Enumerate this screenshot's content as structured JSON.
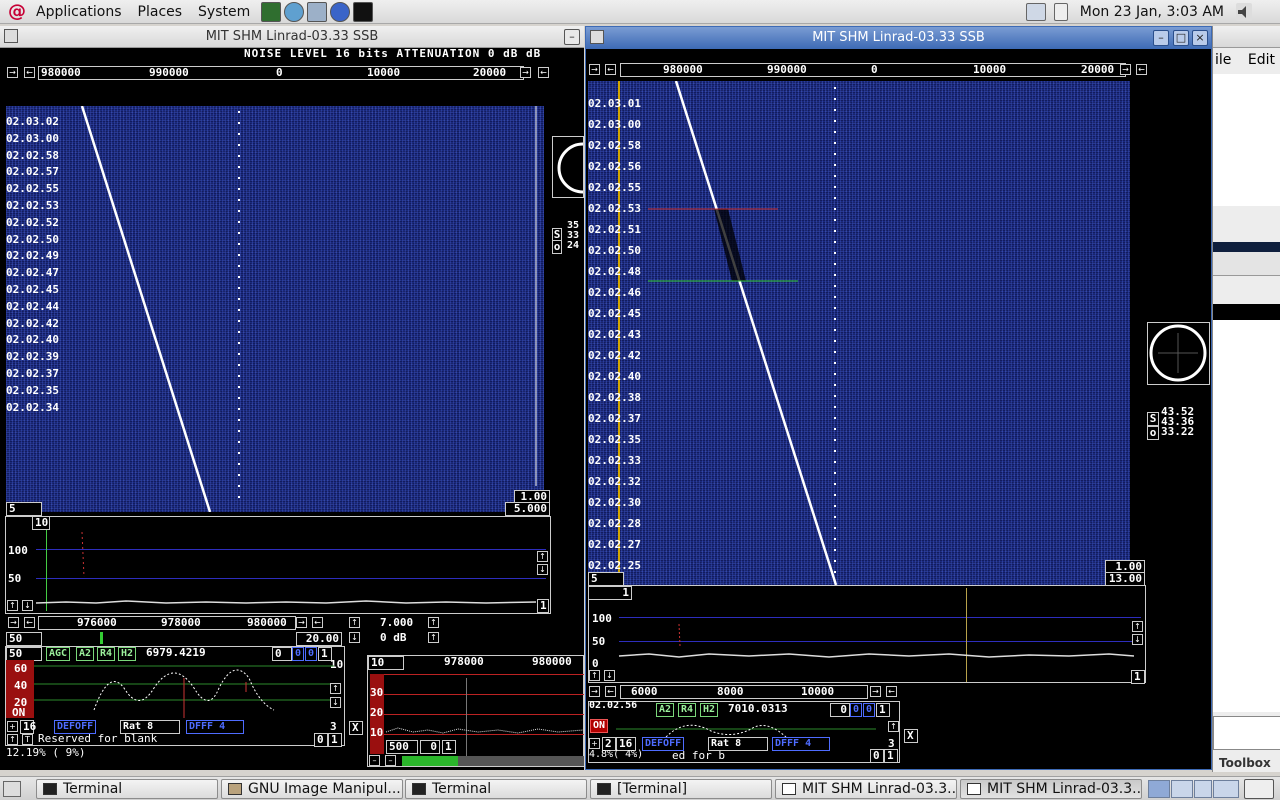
{
  "top_panel": {
    "menus": [
      "Applications",
      "Places",
      "System"
    ],
    "clock": "Mon 23 Jan,  3:03 AM"
  },
  "left_window": {
    "title": "MIT SHM Linrad-03.33 SSB",
    "status_line": "NOISE LEVEL 16 bits ATTENUATION 0 dB dB",
    "freq_scale": [
      "980000",
      "990000",
      "0",
      "10000",
      "20000"
    ],
    "times": [
      "02.03.02",
      "02.03.00",
      "02.02.58",
      "02.02.57",
      "02.02.55",
      "02.02.53",
      "02.02.52",
      "02.02.50",
      "02.02.49",
      "02.02.47",
      "02.02.45",
      "02.02.44",
      "02.02.42",
      "02.02.40",
      "02.02.39",
      "02.02.37",
      "02.02.35",
      "02.02.34"
    ],
    "wf_bottom_left": "5",
    "wf_gain": "1.00",
    "wf_zero": "5.000",
    "side_readout": [
      "35",
      "33",
      "24"
    ],
    "side_labels": [
      "S",
      "o"
    ],
    "spectrum_top_box": "10",
    "spectrum_y": [
      "100",
      "50"
    ],
    "spectrum_right_box": "1",
    "bfo_scale": [
      "976000",
      "978000",
      "980000"
    ],
    "bfo_left_box": "50",
    "bfo_right_box": "20.00",
    "coh_value": "7.000",
    "coh_db": "0 dB",
    "ctrl": {
      "left_box": "50",
      "tags": [
        "AGC",
        "A2",
        "R4",
        "H2"
      ],
      "freq": "6979.4219",
      "right_boxes": [
        "0",
        "0",
        "0",
        "1"
      ],
      "right_num": "10",
      "scale_y": [
        "60",
        "40",
        "20"
      ],
      "on_label": "ON",
      "row2_box": "16",
      "row2_tags": [
        "DEFOFF",
        "Rat  8",
        "DFFF  4"
      ],
      "row2_right": "3",
      "row3_text": "Reserved for blank",
      "row3_boxes": [
        "0",
        "1"
      ],
      "status": "12.19% ( 9%)"
    },
    "mini": {
      "top_box": "10",
      "scale": [
        "978000",
        "980000"
      ],
      "y": [
        "30",
        "20",
        "10"
      ],
      "bottom_boxes": [
        "500",
        "0",
        "1"
      ]
    }
  },
  "right_window": {
    "title": "MIT SHM Linrad-03.33 SSB",
    "freq_scale": [
      "980000",
      "990000",
      "0",
      "10000",
      "20000"
    ],
    "times": [
      "02.03.01",
      "02.03.00",
      "02.02.58",
      "02.02.56",
      "02.02.55",
      "02.02.53",
      "02.02.51",
      "02.02.50",
      "02.02.48",
      "02.02.46",
      "02.02.45",
      "02.02.43",
      "02.02.42",
      "02.02.40",
      "02.02.38",
      "02.02.37",
      "02.02.35",
      "02.02.33",
      "02.02.32",
      "02.02.30",
      "02.02.28",
      "02.02.27",
      "02.02.25"
    ],
    "wf_bottom_left": "5",
    "wf_gain": "1.00",
    "wf_zero": "13.00",
    "side_readout": [
      "43.52",
      "43.36",
      "33.22"
    ],
    "side_labels": [
      "S",
      "o"
    ],
    "spectrum_top_box": "1",
    "spectrum_y": [
      "100",
      "50",
      "0"
    ],
    "spectrum_right_box": "1",
    "bfo_scale": [
      "6000",
      "8000",
      "10000"
    ],
    "ctrl": {
      "time": "02.02.56",
      "tags": [
        "A2",
        "R4",
        "H2"
      ],
      "freq": "7010.0313",
      "right_boxes": [
        "0",
        "0",
        "0",
        "1"
      ],
      "on_label": "ON",
      "row2_boxes": [
        "2",
        "16"
      ],
      "row2_tags": [
        "DEFOFF",
        "Rat  8",
        "DFFF  4"
      ],
      "row2_right": "3",
      "row3_text": "ed for b",
      "row3_boxes": [
        "0",
        "1"
      ],
      "status": "4.8%( 4%)"
    }
  },
  "partial_window": {
    "menus": [
      "ile",
      "Edit"
    ],
    "toolbox": "Toolbox"
  },
  "taskbar": {
    "tasks": [
      "Terminal",
      "GNU Image Manipul...",
      "Terminal",
      "[Terminal]",
      "MIT SHM Linrad-03.3...",
      "MIT SHM Linrad-03.3..."
    ]
  }
}
